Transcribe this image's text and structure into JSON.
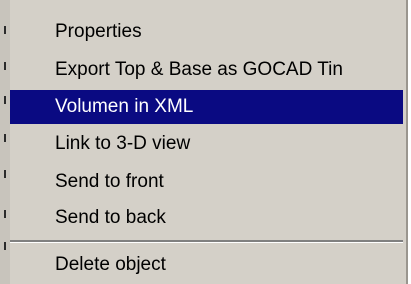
{
  "context_menu": {
    "items": [
      {
        "label": "Properties",
        "selected": false
      },
      {
        "label": "Export Top & Base as GOCAD Tin",
        "selected": false
      },
      {
        "label": "Volumen in XML",
        "selected": true
      },
      {
        "label": "Link to 3-D view",
        "selected": false
      },
      {
        "label": "Send to front",
        "selected": false
      },
      {
        "label": "Send to back",
        "selected": false
      },
      {
        "label": "Delete object",
        "selected": false
      }
    ],
    "colors": {
      "background": "#d4d0c8",
      "highlight": "#0a0a82",
      "highlight_text": "#ffffff",
      "text": "#000000"
    }
  }
}
